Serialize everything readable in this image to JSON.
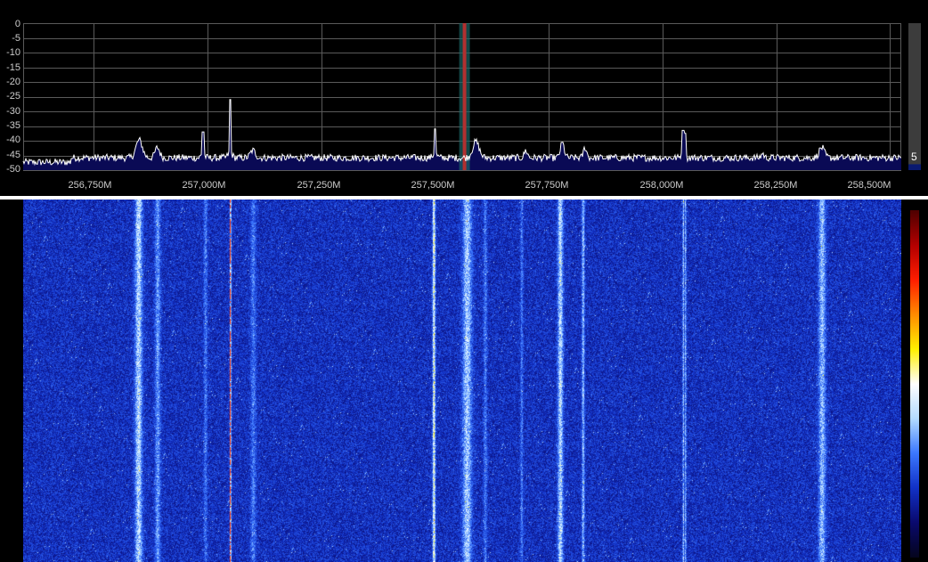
{
  "spectrum": {
    "y_ticks": [
      "0",
      "-5",
      "-10",
      "-15",
      "-20",
      "-25",
      "-30",
      "-35",
      "-40",
      "-45",
      "-50"
    ],
    "y_range": [
      -50,
      0
    ],
    "x_tick_values": [
      256750,
      257000,
      257250,
      257500,
      257750,
      258000,
      258250,
      258500
    ],
    "x_ticks": [
      "256,750M",
      "257,000M",
      "257,250M",
      "257,500M",
      "257,750M",
      "258,000M",
      "258,250M",
      "258,500M"
    ],
    "x_range_khz": [
      256595,
      258525
    ],
    "noise_floor_db": -45,
    "tuned_freq_khz": 257565,
    "signals_khz": [
      256850,
      256890,
      256990,
      257050,
      257100,
      257500,
      257590,
      257700,
      257780,
      257830,
      258045,
      258220,
      258350
    ],
    "spikes_khz": [
      256990,
      257050,
      257500,
      258045,
      258050
    ],
    "colors": {
      "background": "#000000",
      "grid": "#5a5a5a",
      "trace": "#ffffff",
      "fill": "#0a0a55",
      "marker": "#b03030",
      "marker_band": "#1a6a6a"
    }
  },
  "gain": {
    "value_label": "5",
    "level_fraction": 0.04,
    "colors": {
      "track": "#3c3c3c",
      "fill": "#0a1a70"
    }
  },
  "waterfall": {
    "colormap": [
      "#05051e",
      "#0a0a6e",
      "#1232c8",
      "#3c78ff",
      "#b4dcff",
      "#ffffff",
      "#fff000",
      "#ff8c00",
      "#ff1e00",
      "#b40000",
      "#500000"
    ],
    "columns_khz": [
      256848,
      256890,
      256995,
      257050,
      257100,
      257497,
      257570,
      257610,
      257690,
      257775,
      257825,
      258045,
      258050,
      258350
    ]
  }
}
